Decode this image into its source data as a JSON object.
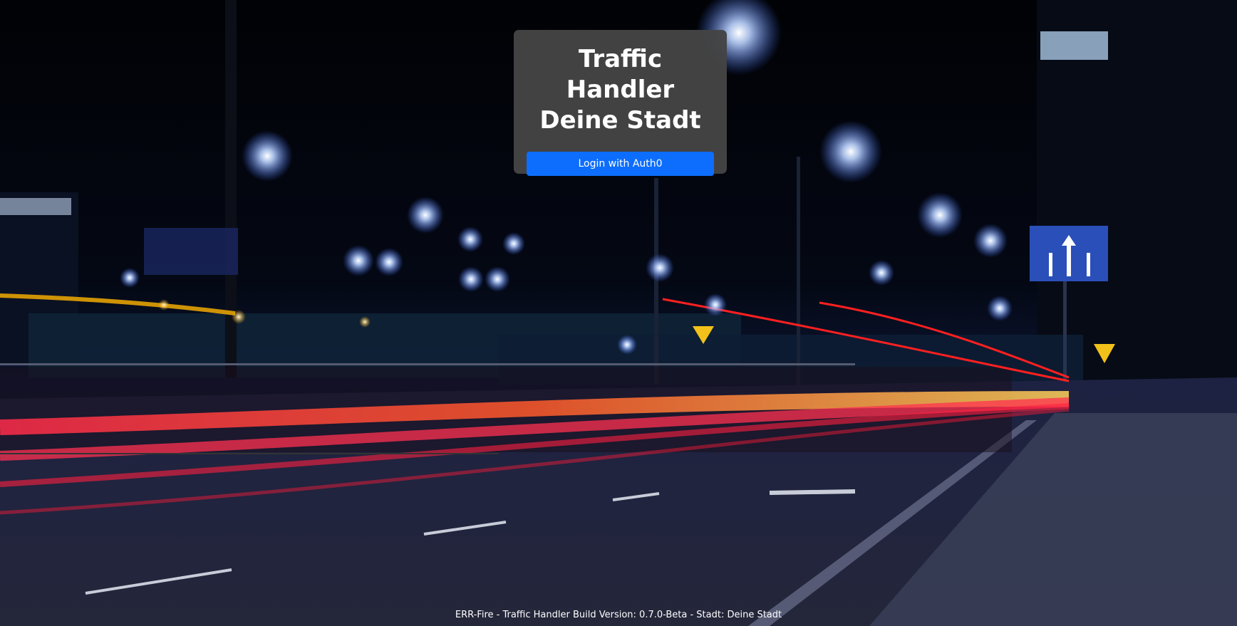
{
  "login": {
    "title_line1": "Traffic Handler",
    "title_line2": "Deine Stadt",
    "button_label": "Login with Auth0"
  },
  "footer": {
    "text": "ERR-Fire - Traffic Handler Build Version: 0.7.0-Beta - Stadt: Deine Stadt"
  },
  "colors": {
    "card_background": "#444444",
    "button": "#0d6efd",
    "text": "#ffffff"
  }
}
